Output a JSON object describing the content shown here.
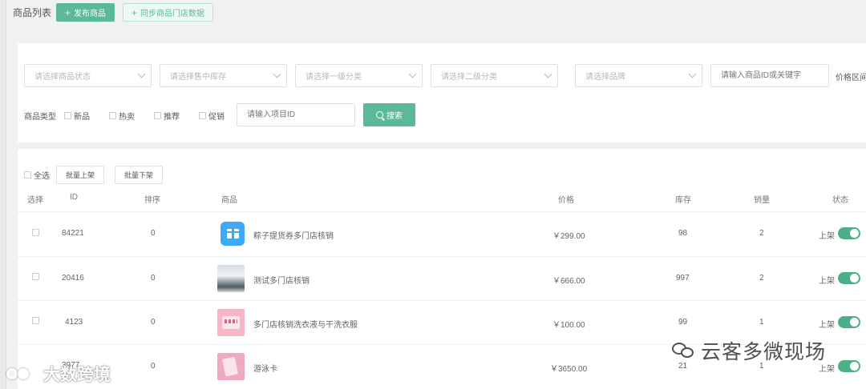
{
  "header": {
    "title": "商品列表",
    "publish_label": "发布商品",
    "sync_label": "同步商品门店数据"
  },
  "filters": {
    "status_placeholder": "请选择商品状态",
    "stock_placeholder": "请选择售中库存",
    "category1_placeholder": "请选择一级分类",
    "category2_placeholder": "请选择二级分类",
    "brand_placeholder": "请选择品牌",
    "keyword_placeholder": "请输入商品ID或关键字",
    "price_label": "价格区间",
    "type_label": "商品类型",
    "types": [
      "新品",
      "热卖",
      "推荐",
      "促销"
    ],
    "project_placeholder": "请输入项目ID",
    "search_label": "搜索"
  },
  "bulk": {
    "select_all": "全选",
    "on_shelf": "批量上架",
    "off_shelf": "批量下架"
  },
  "table": {
    "columns": [
      "选择",
      "ID",
      "排序",
      "商品",
      "价格",
      "库存",
      "销量",
      "状态"
    ],
    "rows": [
      {
        "id": "84221",
        "sort": "0",
        "name": "粽子提货券多门店核销",
        "price": "￥299.00",
        "stock": "98",
        "sales": "2",
        "status": "上架",
        "thumb": "gift-icon"
      },
      {
        "id": "20416",
        "sort": "0",
        "name": "测试多门店核销",
        "price": "￥666.00",
        "stock": "997",
        "sales": "2",
        "status": "上架",
        "thumb": "landscape-photo"
      },
      {
        "id": "4123",
        "sort": "0",
        "name": "多门店核销洗衣液与干洗衣服",
        "price": "￥100.00",
        "stock": "99",
        "sales": "1",
        "status": "上架",
        "thumb": "laundry-photo"
      },
      {
        "id": "3977",
        "sort": "0",
        "name": "游泳卡",
        "price": "￥3650.00",
        "stock": "21",
        "sales": "1",
        "status": "上架",
        "thumb": "card-photo"
      }
    ]
  },
  "watermarks": {
    "wechat": "云客多微现场",
    "weibo": "大数跨境"
  },
  "colors": {
    "primary": "#5bb89a",
    "switch_on": "#4caf86",
    "border": "#dcdfe6"
  }
}
